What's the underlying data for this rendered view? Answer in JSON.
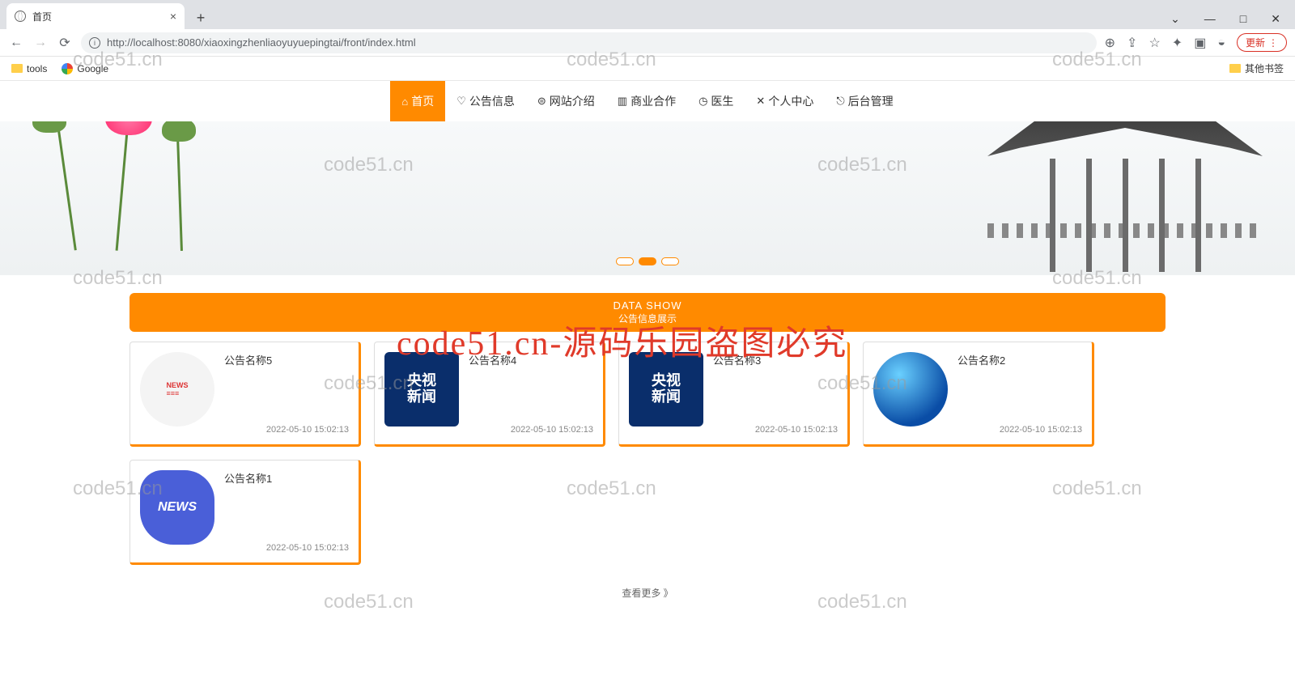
{
  "browser": {
    "tab_title": "首页",
    "url_display": "http://localhost:8080/xiaoxingzhenliaoyuyuepingtai/front/index.html",
    "url_host": "localhost",
    "update_label": "更新",
    "bookmarks": {
      "tools": "tools",
      "google": "Google",
      "other": "其他书签"
    }
  },
  "nav": [
    {
      "icon": "⌂",
      "label": "首页",
      "active": true
    },
    {
      "icon": "♡",
      "label": "公告信息",
      "active": false
    },
    {
      "icon": "⊜",
      "label": "网站介绍",
      "active": false
    },
    {
      "icon": "▥",
      "label": "商业合作",
      "active": false
    },
    {
      "icon": "◷",
      "label": "医生",
      "active": false
    },
    {
      "icon": "✕",
      "label": "个人中心",
      "active": false
    },
    {
      "icon": "⎋",
      "label": "后台管理",
      "active": false
    }
  ],
  "section": {
    "en": "DATA SHOW",
    "cn": "公告信息展示"
  },
  "cards": [
    {
      "title": "公告名称5",
      "time": "2022-05-10 15:02:13",
      "thumb": "newsflat"
    },
    {
      "title": "公告名称4",
      "time": "2022-05-10 15:02:13",
      "thumb": "cctv"
    },
    {
      "title": "公告名称3",
      "time": "2022-05-10 15:02:13",
      "thumb": "cctv"
    },
    {
      "title": "公告名称2",
      "time": "2022-05-10 15:02:13",
      "thumb": "globe3d"
    },
    {
      "title": "公告名称1",
      "time": "2022-05-10 15:02:13",
      "thumb": "newsblob"
    }
  ],
  "view_more": "查看更多 》",
  "watermark": "code51.cn",
  "watermark_red": "code51.cn-源码乐园盗图必究",
  "cctv_text": "央视\n新闻",
  "news_text": "NEWS"
}
